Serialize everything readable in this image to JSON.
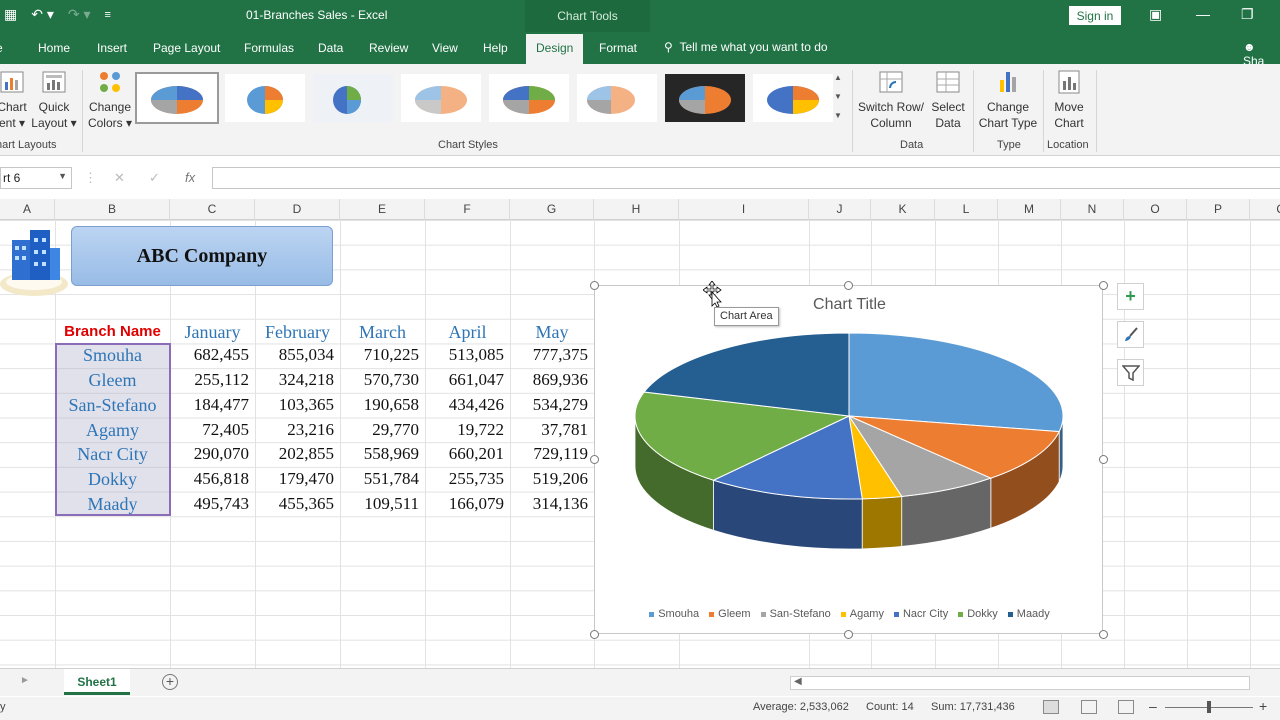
{
  "titlebar": {
    "doc_title": "01-Branches Sales  -  Excel",
    "context_title": "Chart Tools",
    "sign_in": "Sign in"
  },
  "tabs": [
    "Home",
    "Insert",
    "Page Layout",
    "Formulas",
    "Data",
    "Review",
    "View",
    "Help",
    "Design",
    "Format"
  ],
  "active_tab": "Design",
  "tell_me": "Tell me what you want to do",
  "share": "Sha",
  "ribbon": {
    "add_chart_element": [
      "Chart",
      "ent ▾"
    ],
    "quick_layout": [
      "Quick",
      "Layout ▾"
    ],
    "change_colors": [
      "Change",
      "Colors ▾"
    ],
    "group_chart_layouts": "hart Layouts",
    "group_chart_styles": "Chart Styles",
    "switch_row_col": [
      "Switch Row/",
      "Column"
    ],
    "select_data": [
      "Select",
      "Data"
    ],
    "group_data": "Data",
    "change_chart_type": [
      "Change",
      "Chart Type"
    ],
    "group_type": "Type",
    "move_chart": [
      "Move",
      "Chart"
    ],
    "group_location": "Location"
  },
  "formula_bar": {
    "name_box": "rt 6",
    "fx": "fx"
  },
  "columns": [
    "A",
    "B",
    "C",
    "D",
    "E",
    "F",
    "G",
    "H",
    "I",
    "J",
    "K",
    "L",
    "M",
    "N",
    "O",
    "P",
    "Q"
  ],
  "sheet": {
    "company": "ABC Company",
    "branch_header": "Branch Name",
    "months": [
      "January",
      "February",
      "March",
      "April",
      "May"
    ],
    "rows": [
      {
        "branch": "Smouha",
        "values": [
          "682,455",
          "855,034",
          "710,225",
          "513,085",
          "777,375"
        ]
      },
      {
        "branch": "Gleem",
        "values": [
          "255,112",
          "324,218",
          "570,730",
          "661,047",
          "869,936"
        ]
      },
      {
        "branch": "San-Stefano",
        "values": [
          "184,477",
          "103,365",
          "190,658",
          "434,426",
          "534,279"
        ]
      },
      {
        "branch": "Agamy",
        "values": [
          "72,405",
          "23,216",
          "29,770",
          "19,722",
          "37,781"
        ]
      },
      {
        "branch": "Nacr City",
        "values": [
          "290,070",
          "202,855",
          "558,969",
          "660,201",
          "729,119"
        ]
      },
      {
        "branch": "Dokky",
        "values": [
          "456,818",
          "179,470",
          "551,784",
          "255,735",
          "519,206"
        ]
      },
      {
        "branch": "Maady",
        "values": [
          "495,743",
          "455,365",
          "109,511",
          "166,079",
          "314,136"
        ]
      }
    ]
  },
  "chart": {
    "title": "Chart Title",
    "tooltip": "Chart Area",
    "colors": [
      "#5b9bd5",
      "#ed7d31",
      "#a5a5a5",
      "#ffc000",
      "#4472c4",
      "#70ad47",
      "#255e91"
    ],
    "side_buttons": [
      "plus-icon",
      "brush-icon",
      "filter-icon"
    ]
  },
  "chart_data": {
    "type": "pie",
    "title": "Chart Title",
    "categories": [
      "Smouha",
      "Gleem",
      "San-Stefano",
      "Agamy",
      "Nacr City",
      "Dokky",
      "Maady"
    ],
    "values": [
      682455,
      255112,
      184477,
      72405,
      290070,
      456818,
      495743
    ],
    "legend_position": "bottom",
    "style": "3d"
  },
  "sheet_tabs": {
    "active": "Sheet1",
    "add": "+"
  },
  "status": {
    "average": "Average:  2,533,062",
    "count": "Count: 14",
    "sum": "Sum:  17,731,436"
  }
}
